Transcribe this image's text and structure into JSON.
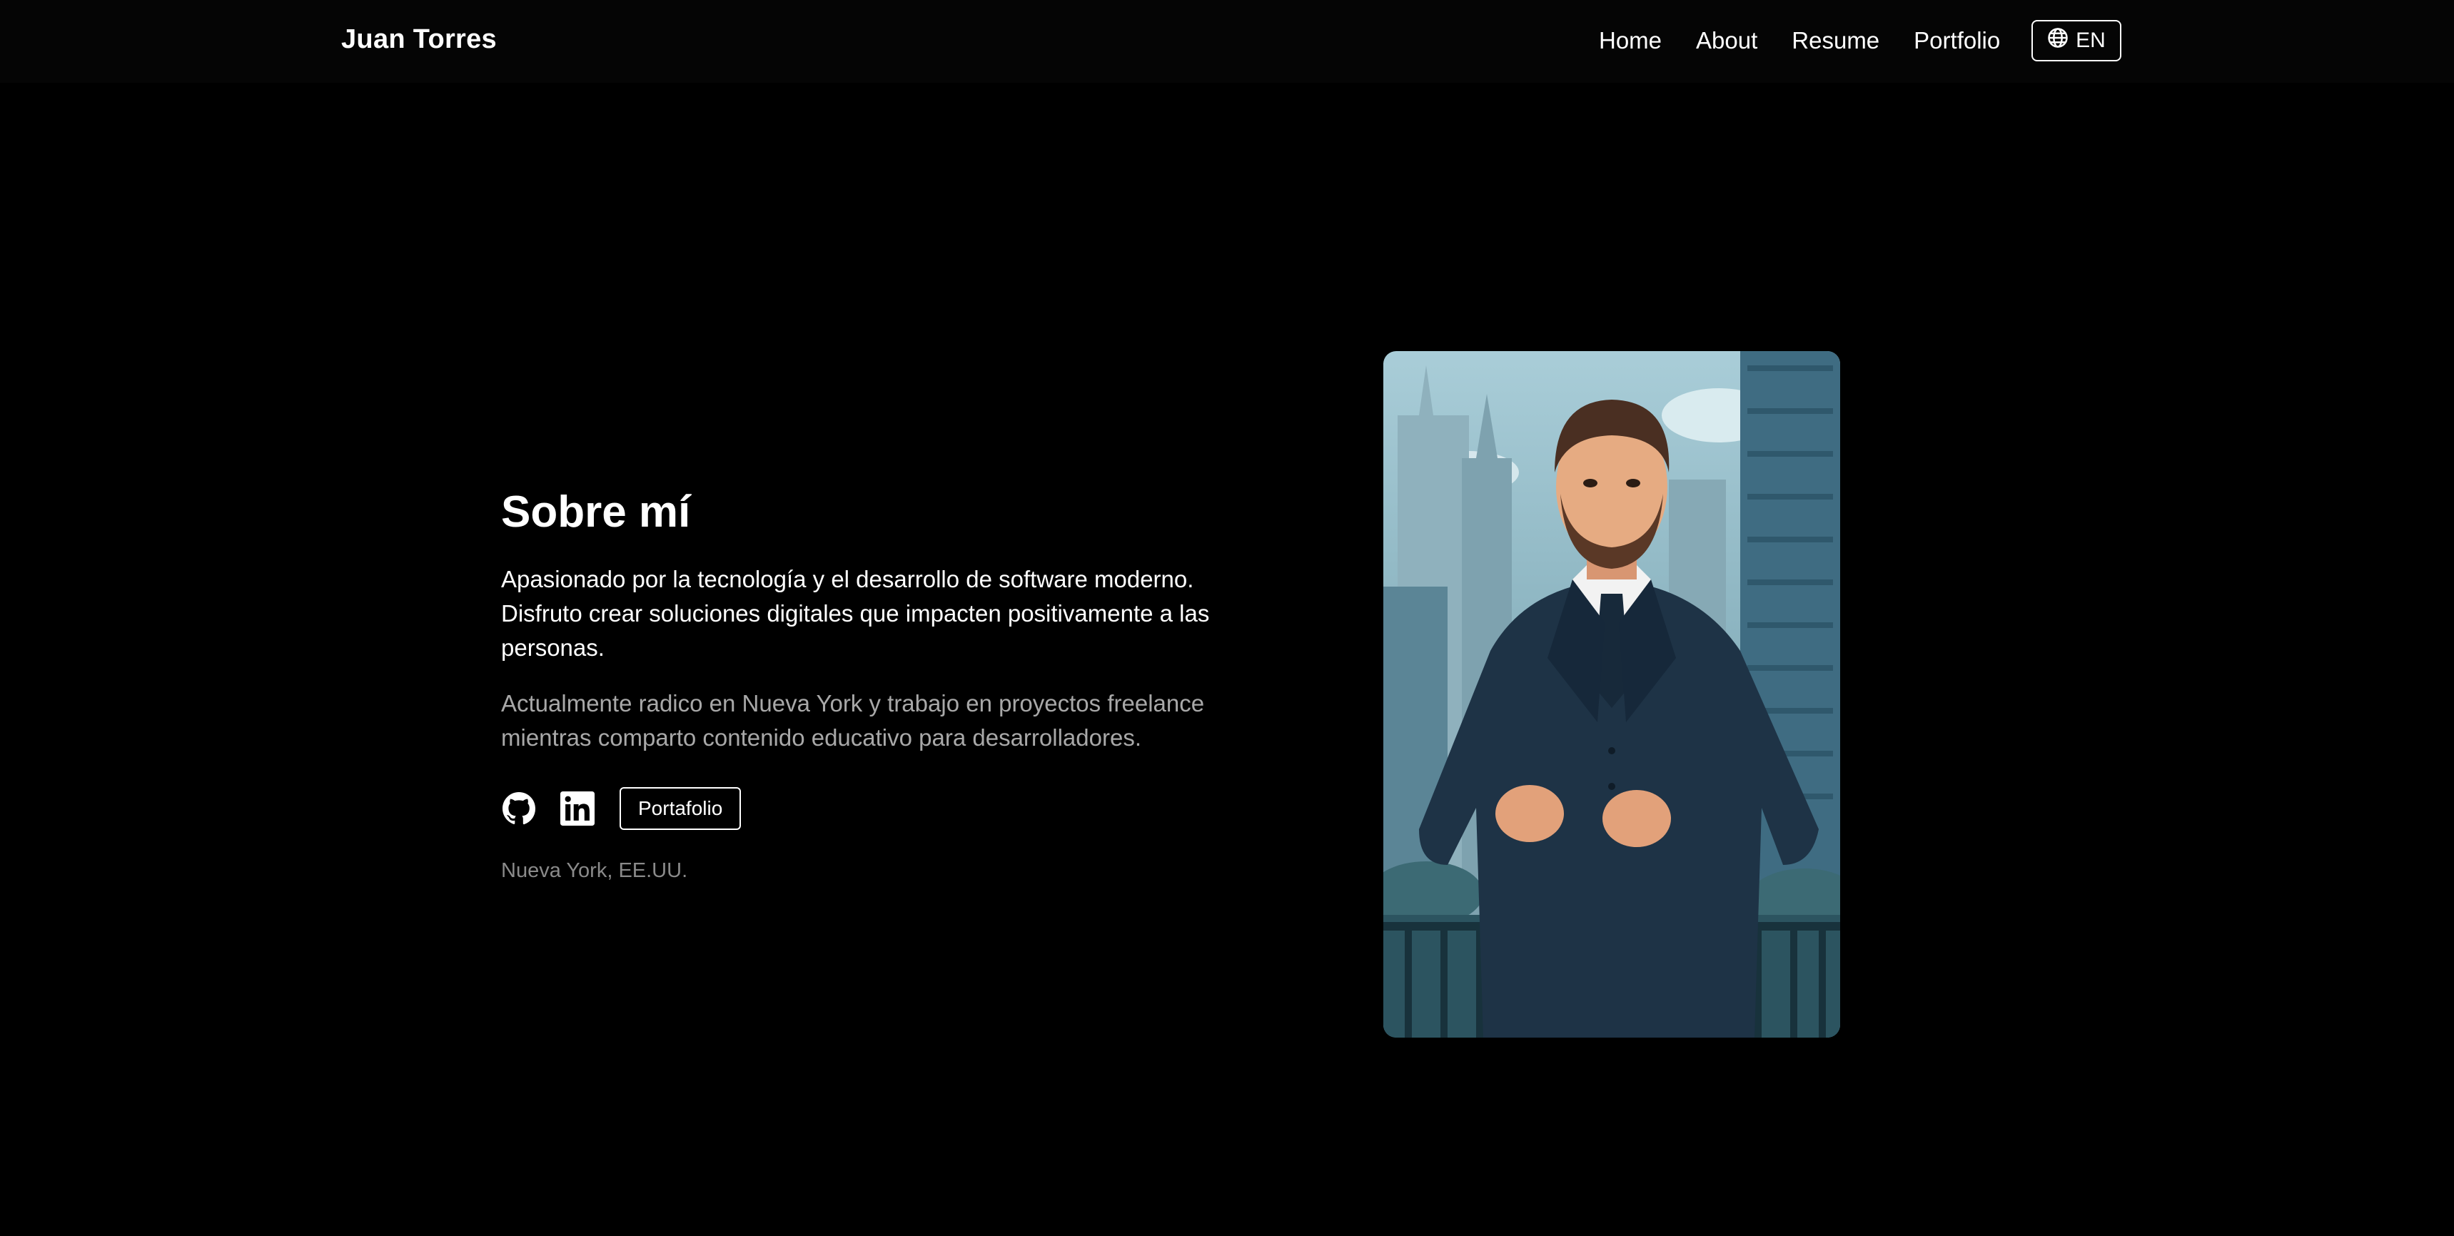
{
  "nav": {
    "brand": "Juan Torres",
    "links": [
      {
        "label": "Home"
      },
      {
        "label": "About"
      },
      {
        "label": "Resume"
      },
      {
        "label": "Portfolio"
      }
    ],
    "language": {
      "label": "EN",
      "icon": "globe-icon"
    }
  },
  "about": {
    "title": "Sobre mí",
    "paragraph1": "Apasionado por la tecnología y el desarrollo de software moderno. Disfruto crear soluciones digitales que impacten positivamente a las personas.",
    "paragraph2": "Actualmente radico en Nueva York y trabajo en proyectos freelance mientras comparto contenido educativo para desarrolladores.",
    "github_icon": "github-icon",
    "linkedin_icon": "linkedin-icon",
    "portfolio_button": "Portafolio",
    "location": "Nueva York, EE.UU."
  },
  "portrait": {
    "icon": "portrait-illustration"
  },
  "colors": {
    "background": "#000000",
    "text": "#ffffff",
    "muted": "#a8a8a8",
    "location": "#8a8a8a"
  }
}
